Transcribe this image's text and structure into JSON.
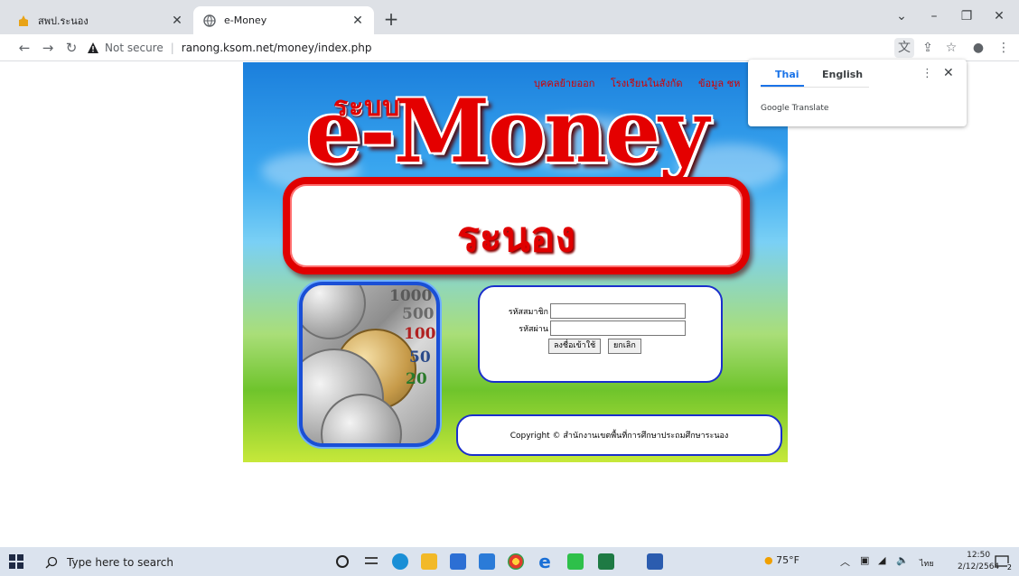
{
  "browser": {
    "tabs": [
      {
        "title": "สพป.ระนอง",
        "active": false
      },
      {
        "title": "e-Money",
        "active": true
      }
    ],
    "new_tab": "+",
    "address": {
      "security": "Not secure",
      "url": "ranong.ksom.net/money/index.php"
    }
  },
  "translate_popup": {
    "lang_from": "Thai",
    "lang_to": "English",
    "brand": "Google Translate"
  },
  "page": {
    "top_nav": [
      "บุคคลย้ายออก",
      "โรงเรียนในสังกัด",
      "ข้อมูล ชห"
    ],
    "sub_title": "ระบบ",
    "title": "e-Money",
    "province": "ระนอง",
    "coin_labels": [
      "1000",
      "500",
      "100",
      "50",
      "20"
    ],
    "login": {
      "member_label": "รหัสสมาชิก",
      "member_value": "",
      "password_label": "รหัสผ่าน",
      "password_value": "",
      "login_button": "ลงชื่อเข้าใช้",
      "cancel_button": "ยกเลิก"
    },
    "copyright": "Copyright © สำนักงานเขตพื้นที่การศึกษาประถมศึกษาระนอง"
  },
  "taskbar": {
    "search_placeholder": "Type here to search",
    "weather": "75°F",
    "language": "ไทย",
    "time": "12:50",
    "date": "2/12/2564",
    "notification_count": "2"
  }
}
